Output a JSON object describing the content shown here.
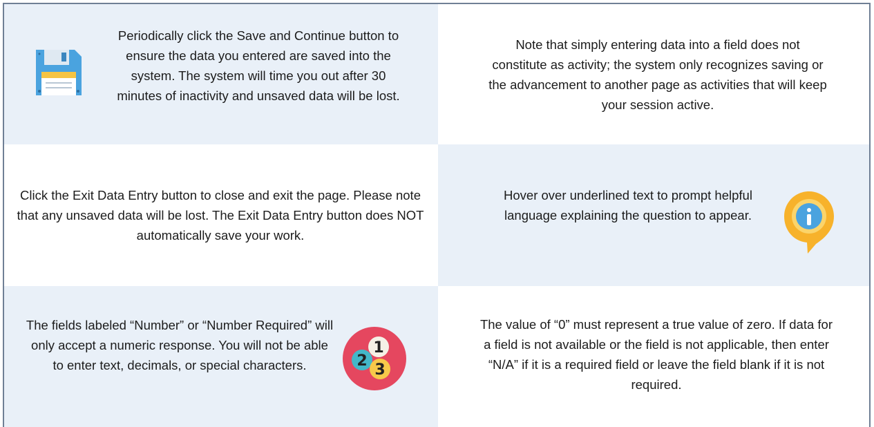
{
  "tips": [
    {
      "id": "save",
      "text": "Periodically click the Save and Continue button to ensure the data you entered are saved into the system. The system will time you out after 30 minutes of inactivity and unsaved data will be lost.",
      "icon": "floppy-disk-icon"
    },
    {
      "id": "activity",
      "text": "Note that simply entering data into a field does not constitute as activity; the system only recognizes saving or the advancement to another page as activities that will keep your session active."
    },
    {
      "id": "exit",
      "text": "Click the Exit Data Entry button to close and exit the page. Please note that any unsaved data will be lost. The Exit Data Entry button does NOT automatically save your work."
    },
    {
      "id": "hover",
      "text": "Hover over underlined text to prompt helpful language explaining the question to appear.",
      "icon": "info-pin-icon"
    },
    {
      "id": "numeric",
      "text": "The fields labeled “Number” or “Number Required” will only accept a numeric response. You will not be able to enter text, decimals, or special characters.",
      "icon": "numbers-icon",
      "icon_numbers": [
        "1",
        "2",
        "3"
      ]
    },
    {
      "id": "zero",
      "text": "The value of “0” must represent a true value of zero. If data for a field is not available or the field is not applicable, then enter “N/A” if it is a required field or leave the field blank if it is not required."
    }
  ],
  "colors": {
    "shade": "#e9f0f8",
    "border": "#6f7f95",
    "floppy": "#4aa3df",
    "info_ring": "#f7b22b",
    "info_core": "#4aa3df",
    "numbers_circle": "#e5475f"
  }
}
